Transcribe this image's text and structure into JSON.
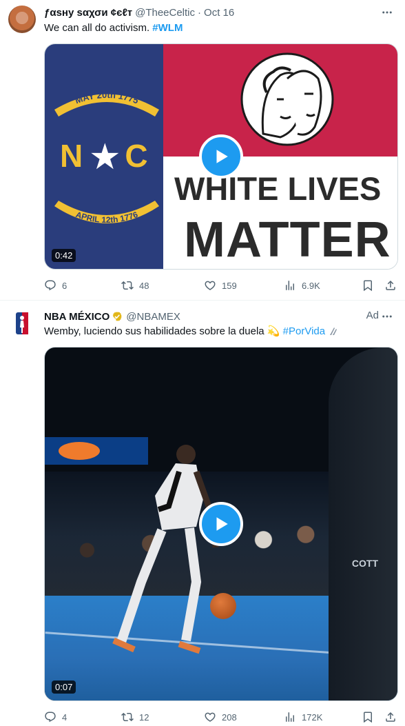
{
  "tweets": [
    {
      "author_name": "ƒαѕнy ѕαχσи ¢єℓт",
      "handle": "@TheeCeltic",
      "separator": "·",
      "date": "Oct 16",
      "text": "We can all do activism. ",
      "hashtag": "#WLM",
      "media": {
        "banner_top": "MAY 20th 1775",
        "banner_bottom": "APRIL 12th 1776",
        "letters": "N    C",
        "line1": "WHITE LIVES",
        "line2": "MATTER",
        "duration": "0:42"
      },
      "stats": {
        "replies": "6",
        "retweets": "48",
        "likes": "159",
        "views": "6.9K"
      }
    },
    {
      "author_name": "NBA MÉXICO",
      "handle": "@NBAMEX",
      "ad_label": "Ad",
      "text": "Wemby, luciendo sus habilidades sobre la duela 💫 ",
      "hashtag": "#PorVida",
      "media": {
        "duration": "0:07",
        "jersey_text": "COTT"
      },
      "stats": {
        "replies": "4",
        "retweets": "12",
        "likes": "208",
        "views": "172K"
      }
    }
  ],
  "icons": [
    "more-icon",
    "reply-icon",
    "retweet-icon",
    "like-icon",
    "views-icon",
    "bookmark-icon",
    "share-icon",
    "play-icon",
    "verified-badge-icon",
    "nba-logo-icon"
  ],
  "colors": {
    "accent": "#1d9bf0",
    "secondary_text": "#536471",
    "gold_badge": "#e2b719"
  }
}
